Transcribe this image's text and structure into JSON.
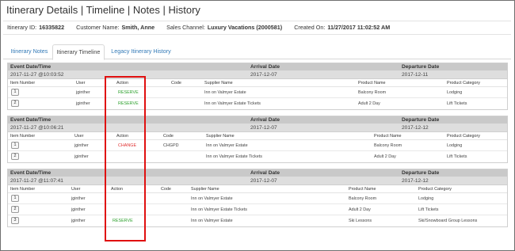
{
  "page": {
    "title": "Itinerary Details | Timeline | Notes | History"
  },
  "info": {
    "itinerary_id_label": "Itinerary ID:",
    "itinerary_id": "16335822",
    "customer_label": "Customer Name:",
    "customer": "Smith, Anne",
    "sales_channel_label": "Sales Channel:",
    "sales_channel": "Luxury Vacations (2000581)",
    "created_label": "Created On:",
    "created": "11/27/2017 11:02:52 AM"
  },
  "tabs": [
    {
      "label": "Itinerary Notes",
      "active": false
    },
    {
      "label": "Itinerary Timeline",
      "active": true
    },
    {
      "label": "Legacy Itinerary History",
      "active": false
    }
  ],
  "columns": {
    "event_date": "Event Date/Time",
    "arrival": "Arrival Date",
    "departure": "Departure Date",
    "item_number": "Item Number",
    "user": "User",
    "action": "Action",
    "code": "Code",
    "supplier": "Supplier Name",
    "product": "Product Name",
    "category": "Product Category"
  },
  "events": [
    {
      "datetime": "2017-11-27 @10:03:52",
      "arrival": "2017-12-07",
      "departure": "2017-12-11",
      "rows": [
        {
          "item": "1",
          "user": "jginther",
          "action": "RESERVE",
          "action_type": "reserve",
          "code": "",
          "supplier": "Inn on Valmyer Estate",
          "product": "Balcony Room",
          "category": "Lodging"
        },
        {
          "item": "2",
          "user": "jginther",
          "action": "RESERVE",
          "action_type": "reserve",
          "code": "",
          "supplier": "Inn on Valmyer Estate Tickets",
          "product": "Adult 2 Day",
          "category": "Lift Tickets"
        }
      ]
    },
    {
      "datetime": "2017-11-27 @10:06:21",
      "arrival": "2017-12-07",
      "departure": "2017-12-12",
      "rows": [
        {
          "item": "1",
          "user": "jginther",
          "action": "CHANGE",
          "action_type": "change",
          "code": "CHGPD",
          "supplier": "Inn on Valmyer Estate",
          "product": "Balcony Room",
          "category": "Lodging"
        },
        {
          "item": "2",
          "user": "jginther",
          "action": "",
          "action_type": "",
          "code": "",
          "supplier": "Inn on Valmyer Estate Tickets",
          "product": "Adult 2 Day",
          "category": "Lift Tickets"
        }
      ]
    },
    {
      "datetime": "2017-11-27 @11:07:41",
      "arrival": "2017-12-07",
      "departure": "2017-12-12",
      "rows": [
        {
          "item": "1",
          "user": "jginther",
          "action": "",
          "action_type": "",
          "code": "",
          "supplier": "Inn on Valmyer Estate",
          "product": "Balcony Room",
          "category": "Lodging"
        },
        {
          "item": "2",
          "user": "jginther",
          "action": "",
          "action_type": "",
          "code": "",
          "supplier": "Inn on Valmyer Estate Tickets",
          "product": "Adult 2 Day",
          "category": "Lift Tickets"
        },
        {
          "item": "3",
          "user": "jginther",
          "action": "RESERVE",
          "action_type": "reserve",
          "code": "",
          "supplier": "Inn on Valmyer Estate",
          "product": "Ski Lessons",
          "category": "Ski/Snowboard Group Lessons"
        }
      ]
    }
  ],
  "colors": {
    "reserve": "#2ca02c",
    "change": "#e03030",
    "highlight": "#e01010",
    "link": "#337ab7"
  }
}
